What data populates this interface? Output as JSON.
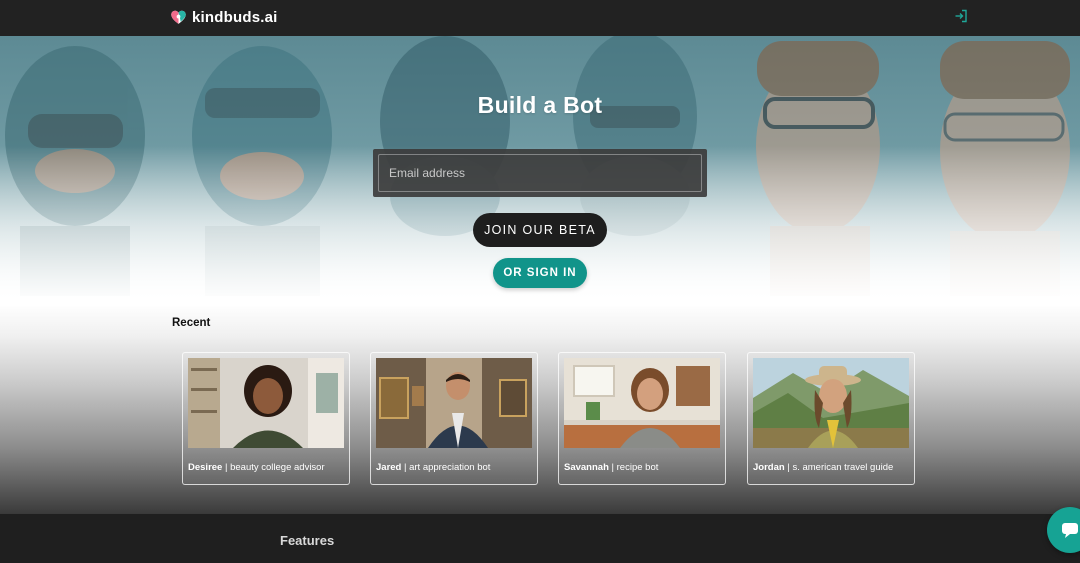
{
  "header": {
    "brand_name": "kindbuds.ai",
    "logo_icon": "heart-logo-icon",
    "login_icon": "login-icon"
  },
  "hero": {
    "title": "Build a Bot",
    "email_placeholder": "Email address",
    "join_label": "JOIN OUR BETA",
    "signin_label": "OR SIGN IN"
  },
  "recent": {
    "label": "Recent",
    "bots": [
      {
        "name": "Desiree",
        "separator": " | ",
        "role": "beauty college advisor"
      },
      {
        "name": "Jared",
        "separator": " | ",
        "role": "art appreciation bot"
      },
      {
        "name": "Savannah",
        "separator": " | ",
        "role": "recipe bot"
      },
      {
        "name": "Jordan",
        "separator": " | ",
        "role": "s. american travel guide"
      }
    ]
  },
  "footer": {
    "features_label": "Features"
  },
  "chat": {
    "icon": "chat-bubble-icon"
  },
  "colors": {
    "accent_teal": "#11948a",
    "nav_bg": "#222222",
    "button_dark": "#1e1e1e"
  }
}
